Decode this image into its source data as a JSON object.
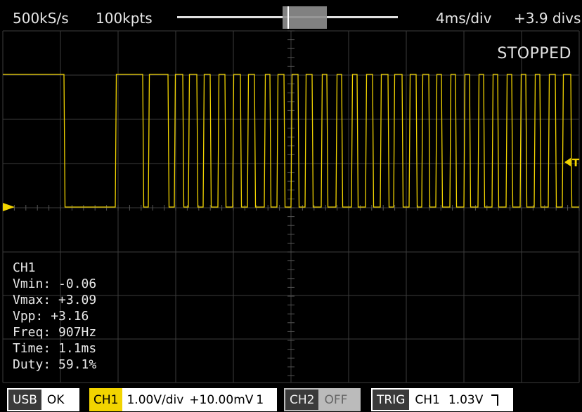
{
  "topbar": {
    "sample_rate": "500kS/s",
    "memory_depth": "100kpts",
    "time_per_div": "4ms/div",
    "horizontal_offset": "+3.9 divs"
  },
  "status": "STOPPED",
  "colors": {
    "ch1": "#f2d400",
    "grid": "#3c3c3c",
    "background": "#000000"
  },
  "trigger_marker": "T",
  "measurements": {
    "channel": "CH1",
    "rows": [
      {
        "label": "Vmin:",
        "value": "-0.06"
      },
      {
        "label": "Vmax:",
        "value": "+3.09"
      },
      {
        "label": "Vpp:",
        "value": "+3.16"
      },
      {
        "label": "Freq:",
        "value": "907Hz"
      },
      {
        "label": "Time:",
        "value": "1.1ms"
      },
      {
        "label": "Duty:",
        "value": "59.1%"
      }
    ]
  },
  "bottombar": {
    "usb": {
      "tag": "USB",
      "value": "OK"
    },
    "ch1": {
      "tag": "CH1",
      "scale": "1.00V/div",
      "offset": "+10.00mV",
      "coupling": "1"
    },
    "ch2": {
      "tag": "CH2",
      "value": "OFF"
    },
    "trig": {
      "tag": "TRIG",
      "source": "CH1",
      "level": "1.03V",
      "edge_icon": "rising-edge-icon"
    }
  }
}
